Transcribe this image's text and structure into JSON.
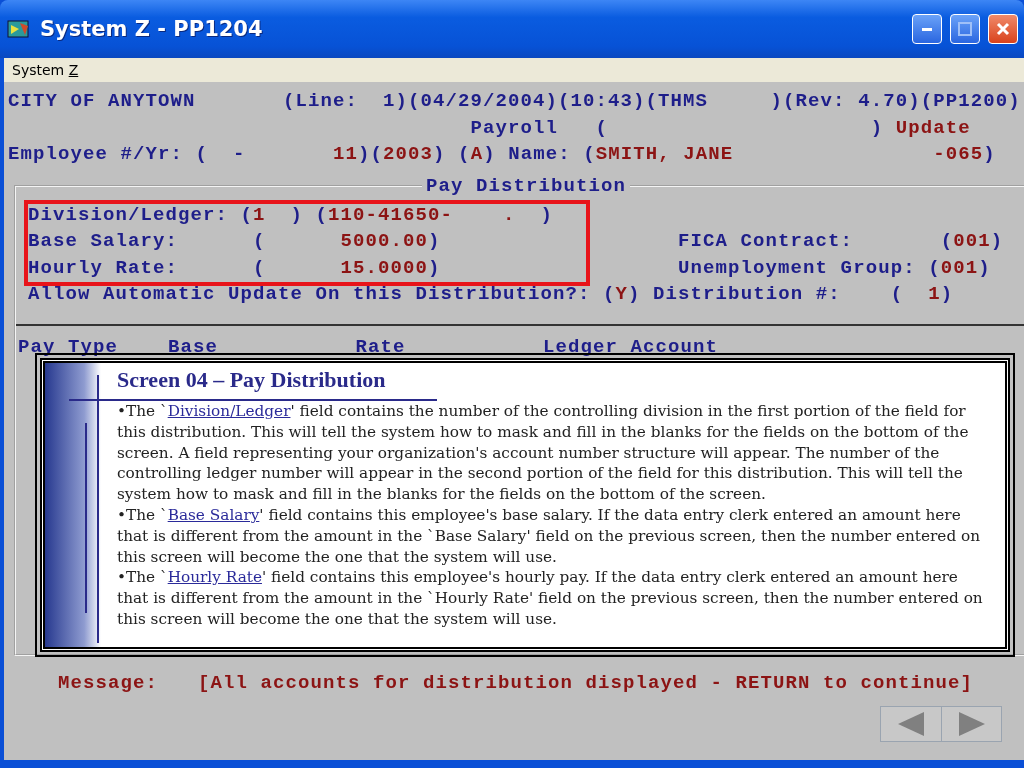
{
  "window": {
    "title": "System Z - PP1204"
  },
  "menu": [
    {
      "label": "System ",
      "accelerator": "Z"
    }
  ],
  "header_lines": [
    [
      {
        "kind": "label",
        "text": "CITY OF ANYTOWN       (Line:  1)(04/29/2004)(10:43)(THMS     )(Rev: 4.70)(PP1200)"
      }
    ],
    [
      {
        "kind": "label",
        "text": "                                     Payroll   (                     ) "
      },
      {
        "kind": "value",
        "text": "Update"
      }
    ],
    [
      {
        "kind": "label",
        "text": "Employee #/Yr: (  -       "
      },
      {
        "kind": "value",
        "text": "11"
      },
      {
        "kind": "label",
        "text": ")("
      },
      {
        "kind": "value",
        "text": "2003"
      },
      {
        "kind": "label",
        "text": ") ("
      },
      {
        "kind": "value",
        "text": "A"
      },
      {
        "kind": "label",
        "text": ") Name: ("
      },
      {
        "kind": "value",
        "text": "SMITH, JANE                -065"
      },
      {
        "kind": "label",
        "text": ")"
      }
    ]
  ],
  "panel": {
    "title": "Pay Distribution",
    "lines": [
      [
        {
          "kind": "label",
          "text": "Division/Ledger: ("
        },
        {
          "kind": "value",
          "text": "1"
        },
        {
          "kind": "label",
          "text": "  ) ("
        },
        {
          "kind": "value",
          "text": "110-41650-    ."
        },
        {
          "kind": "label",
          "text": "  )"
        }
      ],
      [
        {
          "kind": "label",
          "text": "Base Salary:      (      "
        },
        {
          "kind": "value",
          "text": "5000.00"
        },
        {
          "kind": "label",
          "text": ")                   FICA Contract:       ("
        },
        {
          "kind": "value",
          "text": "001"
        },
        {
          "kind": "label",
          "text": ")"
        }
      ],
      [
        {
          "kind": "label",
          "text": "Hourly Rate:      (      "
        },
        {
          "kind": "value",
          "text": "15.0000"
        },
        {
          "kind": "label",
          "text": ")                   Unemployment Group: ("
        },
        {
          "kind": "value",
          "text": "001"
        },
        {
          "kind": "label",
          "text": ")"
        }
      ],
      [
        {
          "kind": "label",
          "text": "Allow Automatic Update On this Distribution?: ("
        },
        {
          "kind": "value",
          "text": "Y"
        },
        {
          "kind": "label",
          "text": ") Distribution #:    (  "
        },
        {
          "kind": "value",
          "text": "1"
        },
        {
          "kind": "label",
          "text": ")"
        }
      ]
    ],
    "table_header": "Pay Type    Base           Rate           Ledger Account"
  },
  "callout": {
    "title": "Screen 04 – Pay Distribution",
    "paragraphs": [
      {
        "before": "•The `",
        "link": "Division/Ledger",
        "after": "' field contains the number of the controlling division in the first portion of the field for this distribution. This will tell the system how to mask and fill in the blanks for the fields on the bottom of the screen.  A field representing your organization's account number structure will appear. The number of the controlling ledger number will appear in the second portion of the field for this distribution. This will tell the system how to mask and fill in the blanks for the fields on the bottom of the screen."
      },
      {
        "before": "•The `",
        "link": "Base Salary",
        "after": "' field contains this employee's base salary.  If the data entry clerk entered an amount here that is different from the amount in the `Base Salary' field on the previous screen, then the number entered on this screen will become the one that the system will use."
      },
      {
        "before": "•The `",
        "link": "Hourly Rate",
        "after": "' field contains this employee's hourly pay. If the data entry clerk entered an amount here that is different from the amount in the `Hourly Rate' field on the previous screen, then the number entered on this screen will become the one that the system will use."
      }
    ]
  },
  "message": {
    "label": "Message:",
    "text": "[All accounts for distribution displayed - RETURN to continue]"
  }
}
